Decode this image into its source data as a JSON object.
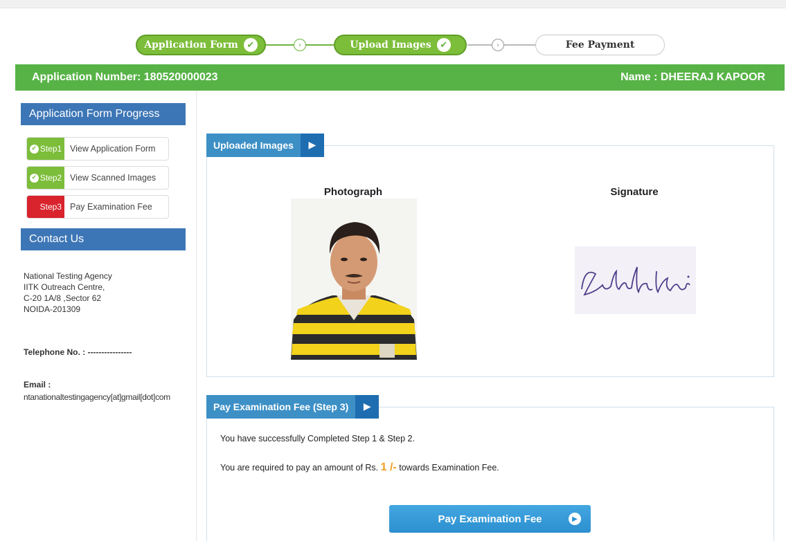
{
  "progress": {
    "step1_label": "Application Form",
    "step2_label": "Upload Images",
    "step3_label": "Fee Payment"
  },
  "header": {
    "application_number": "Application Number: 180520000023",
    "name": "Name : DHEERAJ KAPOOR"
  },
  "sidebar": {
    "progress_title": "Application Form Progress",
    "steps": [
      {
        "badge": "Step1",
        "label": "View Application Form",
        "state": "done"
      },
      {
        "badge": "Step2",
        "label": "View Scanned Images",
        "state": "done"
      },
      {
        "badge": "Step3",
        "label": "Pay Examination Fee",
        "state": "pending"
      }
    ],
    "contact_title": "Contact Us",
    "address": [
      "National Testing Agency",
      "IITK Outreach Centre,",
      "C-20 1A/8 ,Sector 62",
      "NOIDA-201309"
    ],
    "telephone": "Telephone No. : ----------------",
    "email_label": "Email :",
    "email_value": "ntanationaltestingagency[at]gmail[dot]com"
  },
  "uploaded": {
    "tab": "Uploaded Images",
    "photo_label": "Photograph",
    "signature_label": "Signature"
  },
  "payment": {
    "tab": "Pay Examination Fee (Step 3)",
    "message1": "You have successfully Completed Step 1 & Step 2.",
    "message2_prefix": "You are required to pay an amount of Rs.",
    "amount": "1 /-",
    "message2_suffix": "towards Examination Fee.",
    "button": "Pay Examination Fee"
  },
  "colors": {
    "green": "#57b346",
    "blue": "#3d76b6",
    "tab_blue": "#3d90c6",
    "red": "#d9232d",
    "amount_orange": "#f39c20"
  }
}
